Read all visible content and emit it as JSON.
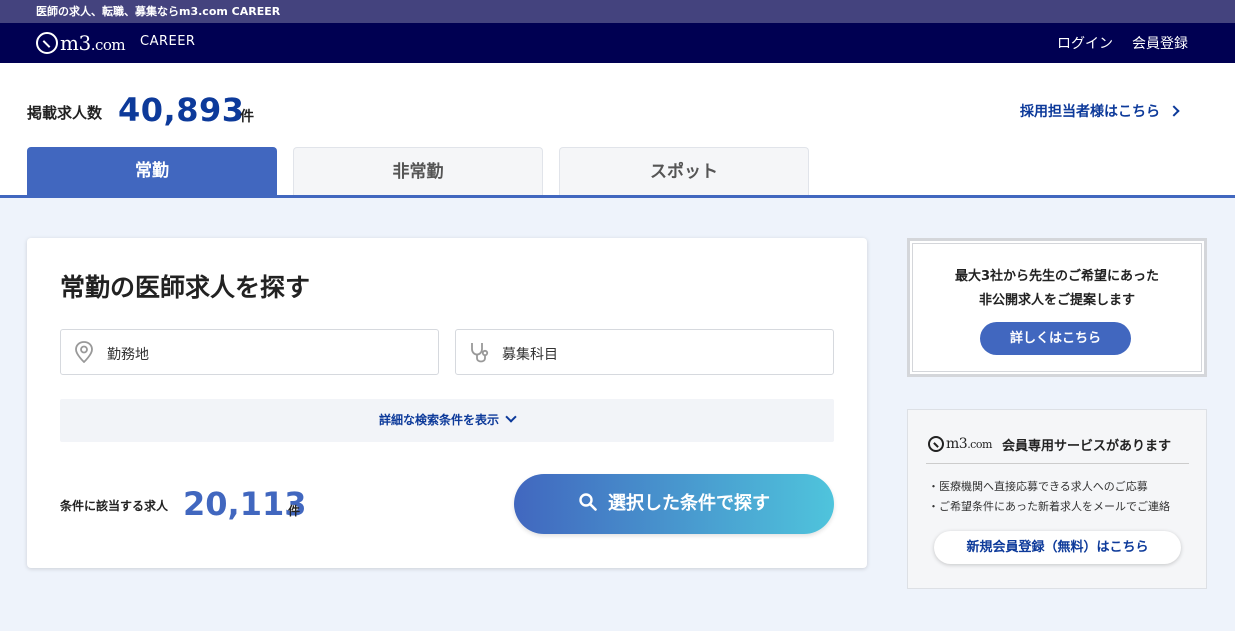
{
  "top_strip": {
    "text": "医師の求人、転職、募集ならm3.com CAREER"
  },
  "header": {
    "logo_text": "m3",
    "logo_suffix": ".com",
    "career_label": "CAREER",
    "login_label": "ログイン",
    "register_label": "会員登録"
  },
  "listing": {
    "label": "掲載求人数",
    "count": "40,893",
    "unit": "件",
    "recruiter_link": "採用担当者様はこちら"
  },
  "tabs": [
    {
      "label": "常勤",
      "active": true
    },
    {
      "label": "非常勤",
      "active": false
    },
    {
      "label": "スポット",
      "active": false
    }
  ],
  "search": {
    "title": "常勤の医師求人を探す",
    "location_field": "勤務地",
    "specialty_field": "募集科目",
    "advanced_toggle": "詳細な検索条件を表示",
    "match_label": "条件に該当する求人",
    "match_count": "20,113",
    "match_unit": "件",
    "button_label": "選択した条件で探す"
  },
  "promo_private": {
    "line1": "最大3社から先生のご希望にあった",
    "line2": "非公開求人をご提案します",
    "button_label": "詳しくはこちら"
  },
  "promo_member": {
    "logo_text": "m3",
    "logo_suffix": ".com",
    "title": "会員専用サービスがあります",
    "bullets": [
      "・医療機関へ直接応募できる求人へのご応募",
      "・ご希望条件にあった新着求人をメールでご連絡"
    ],
    "button_label": "新規会員登録（無料）はこちら"
  },
  "colors": {
    "primary": "#4167bf",
    "navy": "#000052",
    "strip": "#44437e",
    "link": "#0d3a9a",
    "gradient_end": "#4fc4dc"
  },
  "icons": [
    "location-pin-icon",
    "stethoscope-icon",
    "chevron-right-icon",
    "chevron-down-icon",
    "search-icon"
  ]
}
